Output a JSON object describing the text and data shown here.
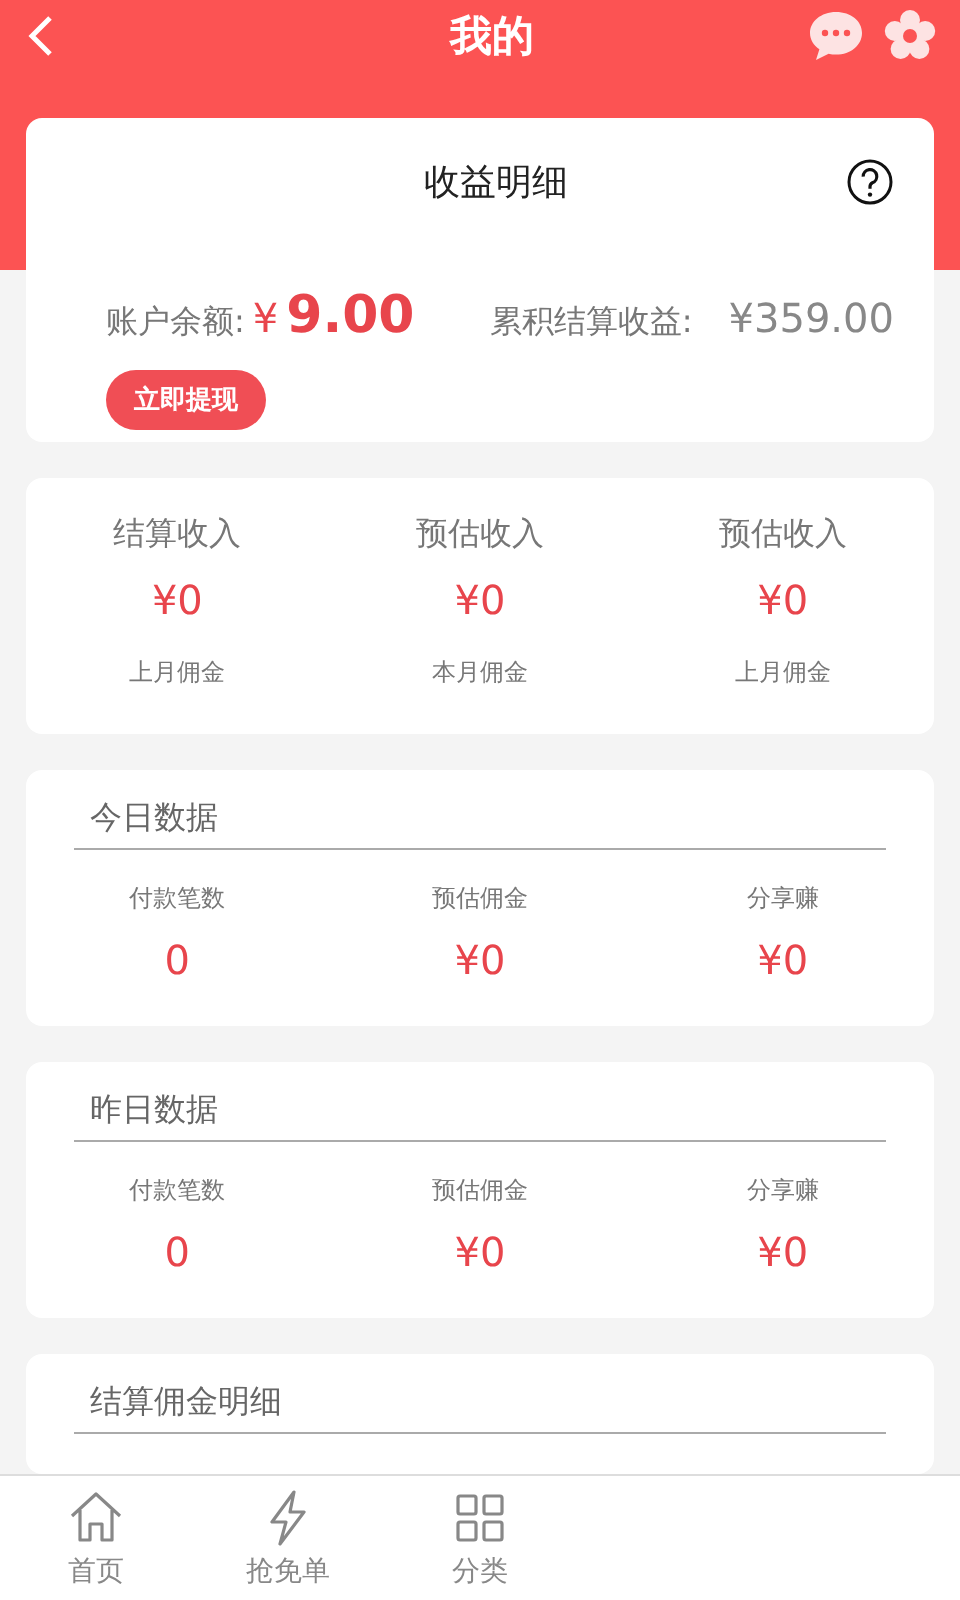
{
  "header": {
    "title": "我的"
  },
  "summary": {
    "title": "收益明细",
    "balance_label": "账户余额:",
    "balance_currency": "¥",
    "balance_amount": "9.00",
    "total_label": "累积结算收益:",
    "total_value": "¥359.00",
    "withdraw_button": "立即提现"
  },
  "income": [
    {
      "title": "结算收入",
      "value": "¥0",
      "note": "上月佣金"
    },
    {
      "title": "预估收入",
      "value": "¥0",
      "note": "本月佣金"
    },
    {
      "title": "预估收入",
      "value": "¥0",
      "note": "上月佣金"
    }
  ],
  "today": {
    "title": "今日数据",
    "items": [
      {
        "label": "付款笔数",
        "value": "0"
      },
      {
        "label": "预估佣金",
        "value": "¥0"
      },
      {
        "label": "分享赚",
        "value": "¥0"
      }
    ]
  },
  "yesterday": {
    "title": "昨日数据",
    "items": [
      {
        "label": "付款笔数",
        "value": "0"
      },
      {
        "label": "预估佣金",
        "value": "¥0"
      },
      {
        "label": "分享赚",
        "value": "¥0"
      }
    ]
  },
  "settlement": {
    "title": "结算佣金明细"
  },
  "tabs": [
    {
      "label": "首页",
      "selected": false
    },
    {
      "label": "抢免单",
      "selected": false
    },
    {
      "label": "分类",
      "selected": false
    }
  ]
}
